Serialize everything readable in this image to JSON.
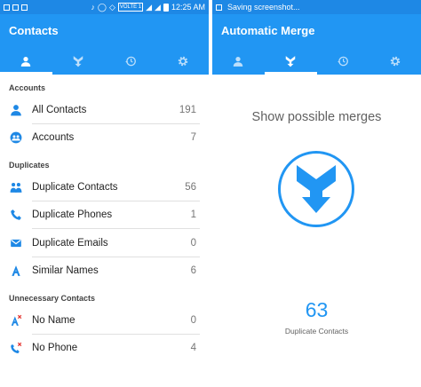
{
  "left": {
    "status": {
      "time": "12:25 AM",
      "volte": "VOLTE 1"
    },
    "title": "Contacts",
    "sections": [
      {
        "header": "Accounts",
        "items": [
          {
            "label": "All Contacts",
            "count": "191",
            "icon": "person-icon"
          },
          {
            "label": "Accounts",
            "count": "7",
            "icon": "accounts-icon"
          }
        ]
      },
      {
        "header": "Duplicates",
        "items": [
          {
            "label": "Duplicate Contacts",
            "count": "56",
            "icon": "people-icon"
          },
          {
            "label": "Duplicate Phones",
            "count": "1",
            "icon": "phone-icon"
          },
          {
            "label": "Duplicate Emails",
            "count": "0",
            "icon": "email-icon"
          },
          {
            "label": "Similar Names",
            "count": "6",
            "icon": "letter-a-icon"
          }
        ]
      },
      {
        "header": "Unnecessary Contacts",
        "items": [
          {
            "label": "No Name",
            "count": "0",
            "icon": "letter-a-x-icon"
          },
          {
            "label": "No Phone",
            "count": "4",
            "icon": "phone-x-icon"
          }
        ]
      }
    ]
  },
  "right": {
    "status": {
      "notification": "Saving screenshot..."
    },
    "title": "Automatic Merge",
    "headline": "Show possible merges",
    "count": "63",
    "caption": "Duplicate Contacts"
  },
  "tabs": [
    "contacts-tab",
    "merge-tab",
    "history-tab",
    "settings-tab"
  ],
  "colors": {
    "primary": "#2196f3",
    "statusbar": "#1e88e5",
    "accent_icon": "#1e88e5",
    "red_x": "#e53935"
  }
}
